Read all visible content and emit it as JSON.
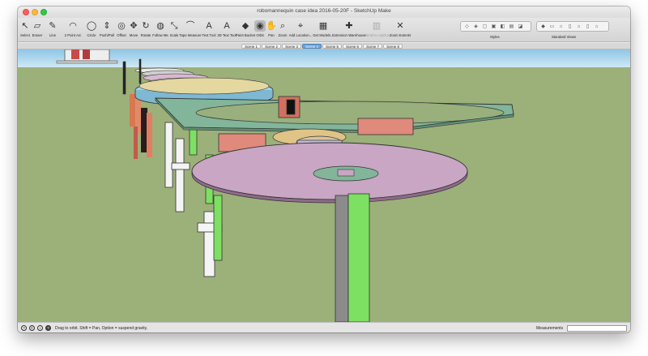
{
  "window": {
    "title": "robomannequin case idea 2016-05-20F - SketchUp Make"
  },
  "toolbar": {
    "tools": [
      {
        "key": "select",
        "label": "Select",
        "icon": "arrow-pointer-icon"
      },
      {
        "key": "eraser",
        "label": "Eraser",
        "icon": "eraser-icon"
      },
      {
        "key": "line",
        "label": "Line",
        "icon": "pencil-icon"
      },
      {
        "key": "arc",
        "label": "2 Point Arc",
        "icon": "arc-icon"
      },
      {
        "key": "circle",
        "label": "Circle",
        "icon": "circle-icon"
      },
      {
        "key": "pushpull",
        "label": "Push/Pull",
        "icon": "push-pull-icon"
      },
      {
        "key": "offset",
        "label": "Offset",
        "icon": "offset-icon"
      },
      {
        "key": "move",
        "label": "Move",
        "icon": "move-arrows-icon"
      },
      {
        "key": "rotate",
        "label": "Rotate",
        "icon": "rotate-icon"
      },
      {
        "key": "followme",
        "label": "Follow Me",
        "icon": "follow-me-icon"
      },
      {
        "key": "scale",
        "label": "Scale",
        "icon": "scale-icon"
      },
      {
        "key": "tapemeasure",
        "label": "Tape Measure",
        "icon": "tape-measure-icon"
      },
      {
        "key": "text",
        "label": "Text Tool",
        "icon": "text-icon"
      },
      {
        "key": "3dtext",
        "label": "3D Text Tool",
        "icon": "3d-text-icon"
      },
      {
        "key": "paintbucket",
        "label": "Paint Bucket",
        "icon": "paint-bucket-icon"
      },
      {
        "key": "orbit",
        "label": "Orbit",
        "icon": "orbit-icon"
      },
      {
        "key": "pan",
        "label": "Pan",
        "icon": "hand-icon"
      },
      {
        "key": "zoom",
        "label": "Zoom",
        "icon": "magnifier-icon"
      },
      {
        "key": "addlocation",
        "label": "Add Location...",
        "icon": "map-pin-icon"
      },
      {
        "key": "get_models",
        "label": "Get Models...",
        "icon": "warehouse-icon"
      },
      {
        "key": "ext_warehouse",
        "label": "Extension Warehouse",
        "icon": "extension-icon"
      },
      {
        "key": "send_layout",
        "label": "Send to LayOut",
        "icon": "layout-icon"
      },
      {
        "key": "zoom_extents",
        "label": "Zoom Extents",
        "icon": "zoom-extents-icon"
      }
    ],
    "active_tool": "orbit",
    "styles_label": "Styles",
    "standard_views_label": "Standard Views"
  },
  "scenes": {
    "tabs": [
      "Scene 1",
      "Scene 2",
      "Scene 3",
      "Scene 4",
      "Scene 5",
      "Scene 6",
      "Scene 7",
      "Scene 8"
    ],
    "active_index": 3
  },
  "status": {
    "hint": "Drag to orbit. Shift = Pan, Option = suspend gravity.",
    "measurements_label": "Measurements",
    "measurements_value": ""
  },
  "colors": {
    "sky": "#a9d4ec",
    "ground": "#9cb07a",
    "pink_disk": "#c9a6c4",
    "green_plate": "#82b59a",
    "green_pole": "#7ee062",
    "blue_plate": "#9fd2e8",
    "brown_block": "#e08a7b",
    "active_scene": "#6aa4dc"
  }
}
